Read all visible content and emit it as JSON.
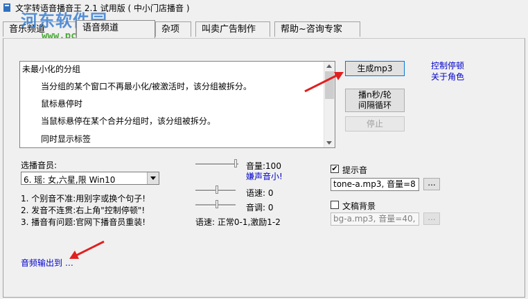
{
  "window": {
    "title": "文字转语音播音王 2.1 试用版 ( 中小门店播音 )",
    "watermark": "河东软件园",
    "watermark_url": "www.pc0359.cn"
  },
  "tabs": [
    {
      "label": "音乐频道"
    },
    {
      "label": "语音频道"
    },
    {
      "label": "杂项"
    },
    {
      "label": "叫卖广告制作"
    },
    {
      "label": "帮助~咨询专家"
    }
  ],
  "list": {
    "lines": [
      "未最小化的分组",
      "当分组的某个窗口不再最小化/被激活时，该分组被拆分。",
      "鼠标悬停时",
      "当鼠标悬停在某个合并分组时，该分组被拆分。",
      "同时显示标签"
    ]
  },
  "buttons": {
    "generate_mp3": "生成mp3",
    "play_loop": "播n秒/轮\n间隔循环",
    "stop": "停止"
  },
  "links": {
    "control_pause": "控制停顿",
    "about_roles": "关于角色",
    "volume_low": "嫌声音小!",
    "audio_output": "音频输出到 …"
  },
  "voice": {
    "label": "选播音员:",
    "selected": "6. 瑶: 女,六星,限 Win10",
    "tips": [
      "1. 个别音不准:用别字或换个句子!",
      "2. 发音不连贯:右上角\"控制停顿\"!",
      "3. 播音有问题:官网下播音员重装!"
    ]
  },
  "sliders": {
    "volume_label": "音量:100",
    "volume_value": 100,
    "speed_label": "语速: 0",
    "speed_value": 0,
    "pitch_label": "音调: 0",
    "pitch_value": 0,
    "speed_hint": "语速: 正常0-1,激励1-2"
  },
  "prompt_tone": {
    "label": "提示音",
    "checked": true,
    "value": "tone-a.mp3, 音量=8",
    "browse": "..."
  },
  "bg_music": {
    "label": "文稿背景",
    "checked": false,
    "value": "bg-a.mp3, 音量=40,",
    "browse": "..."
  },
  "colors": {
    "link": "#0000cc",
    "arrow": "#e02020",
    "watermark": "#3b7fd0",
    "watermark_url": "#4caa3a"
  }
}
